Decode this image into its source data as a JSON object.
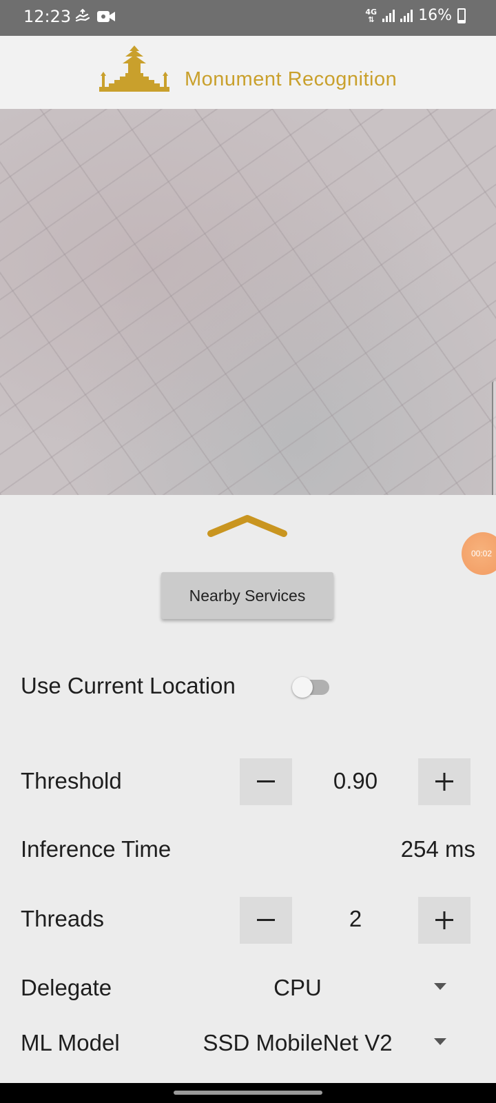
{
  "status_bar": {
    "time": "12:23",
    "network": "4G",
    "battery": "16%"
  },
  "header": {
    "title": "Monument Recognition"
  },
  "colors": {
    "accent_gold": "#c9a02c",
    "chevron": "#c99520",
    "sheet_bg": "#ececec"
  },
  "bottom_sheet": {
    "recording_timer": "00:02",
    "nearby_services_label": "Nearby Services",
    "location": {
      "label": "Use Current Location",
      "enabled": false
    },
    "threshold": {
      "label": "Threshold",
      "value": "0.90",
      "minus": "minus-icon",
      "plus": "plus-icon"
    },
    "inference": {
      "label": "Inference Time",
      "value": "254 ms"
    },
    "threads": {
      "label": "Threads",
      "value": "2"
    },
    "delegate": {
      "label": "Delegate",
      "value": "CPU"
    },
    "ml_model": {
      "label": "ML Model",
      "value": "SSD MobileNet V2"
    }
  }
}
